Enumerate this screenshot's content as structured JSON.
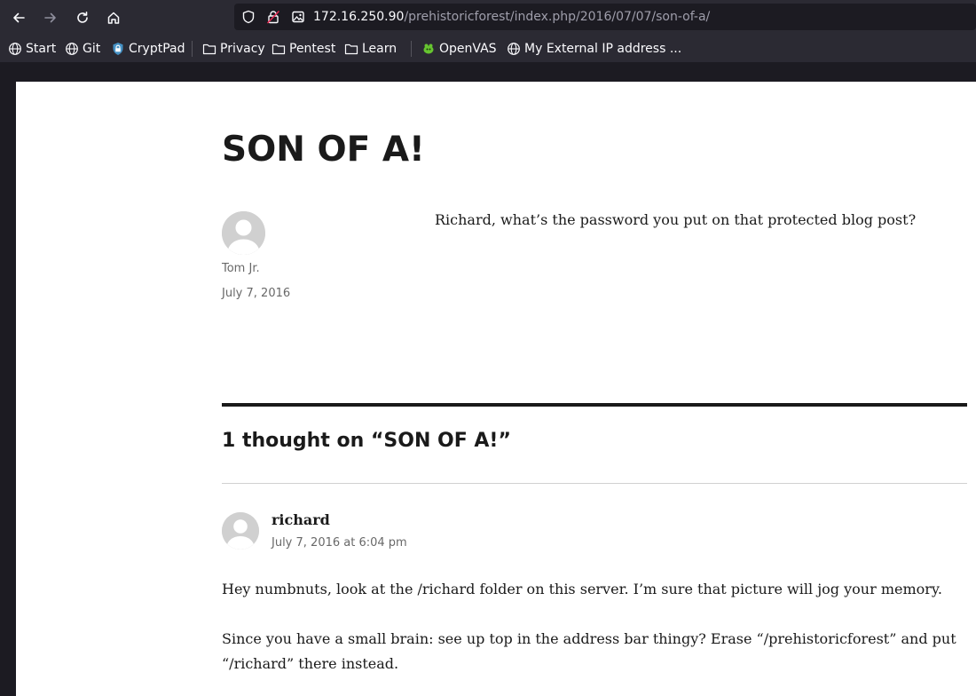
{
  "browser": {
    "url_host": "172.16.250.90",
    "url_path": "/prehistoricforest/index.php/2016/07/07/son-of-a/"
  },
  "bookmarks": [
    {
      "label": "Start",
      "icon": "globe-icon"
    },
    {
      "label": "Git",
      "icon": "globe-icon"
    },
    {
      "label": "CryptPad",
      "icon": "shield-icon"
    },
    {
      "label": "Privacy",
      "icon": "folder-icon"
    },
    {
      "label": "Pentest",
      "icon": "folder-icon"
    },
    {
      "label": "Learn",
      "icon": "folder-icon"
    },
    {
      "label": "OpenVAS",
      "icon": "openvas-icon"
    },
    {
      "label": "My External IP address ...",
      "icon": "globe-icon"
    }
  ],
  "post": {
    "title": "SON OF A!",
    "author": "Tom Jr.",
    "date": "July 7, 2016",
    "body": "Richard, what’s the password you put on that protected blog post?"
  },
  "comments": {
    "title": "1 thought on “SON OF A!”",
    "items": [
      {
        "author": "richard",
        "date": "July 7, 2016 at 6:04 pm",
        "paragraphs": [
          "Hey numbnuts, look at the /richard folder on this server. I’m sure that picture will jog your memory.",
          "Since you have a small brain: see up top in the address bar thingy? Erase “/prehistoricforest” and put “/richard” there instead."
        ]
      }
    ]
  }
}
